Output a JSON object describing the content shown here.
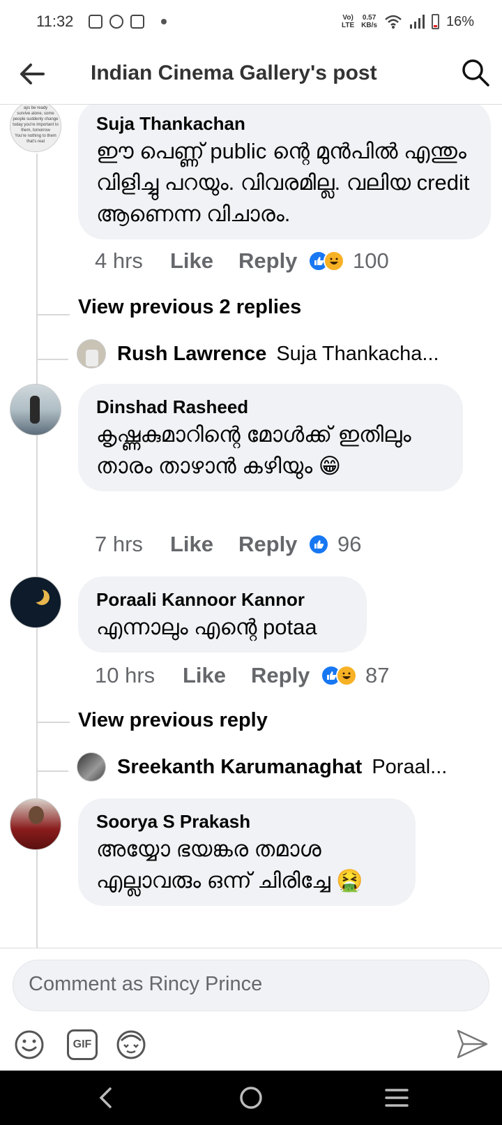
{
  "status": {
    "time": "11:32",
    "lte": "LTE",
    "speed_value": "0.57",
    "speed_unit": "KB/s",
    "battery": "16%",
    "volte": "Vo)"
  },
  "header": {
    "title": "Indian Cinema Gallery's post"
  },
  "comments": [
    {
      "author": "Suja Thankachan",
      "text": "ഈ പെണ്ണ് public ന്റെ മുൻപിൽ എന്തും വിളിച്ചു പറയും. വിവരമില്ല. വലിയ credit ആണെന്ന വിചാരം.",
      "time": "4 hrs",
      "like": "Like",
      "reply": "Reply",
      "reaction_count": "100",
      "view_previous": "View previous 2 replies",
      "latest_reply_name": "Rush Lawrence",
      "latest_reply_preview": "Suja Thankacha..."
    },
    {
      "author": "Dinshad Rasheed",
      "text": "കൃഷ്ണകുമാറിന്റെ മോൾക്ക് ഇതിലും താരം താഴാൻ കഴിയും 😁",
      "time": "7 hrs",
      "like": "Like",
      "reply": "Reply",
      "reaction_count": "96"
    },
    {
      "author": "Poraali Kannoor Kannor",
      "text": "എന്നാലും എന്റെ potaa",
      "time": "10 hrs",
      "like": "Like",
      "reply": "Reply",
      "reaction_count": "87",
      "view_previous": "View previous reply",
      "latest_reply_name": "Sreekanth Karumanaghat",
      "latest_reply_preview": "Poraal..."
    },
    {
      "author": "Soorya S Prakash",
      "text": "അയ്യോ ഭയങ്കര തമാശ എല്ലാവരും ഒന്ന് ചിരിച്ചേ 🤮"
    }
  ],
  "avatar_text": [
    "ays be ready",
    "survive alone, some",
    "people suddenly change",
    "today you're important to",
    "them, tomorrow",
    "You're nothing to them",
    "that's real"
  ],
  "composer": {
    "placeholder": "Comment as Rincy Prince",
    "gif": "GIF"
  },
  "colors": {
    "bubble": "#f0f2f5",
    "like_blue": "#1877f2",
    "haha_yellow": "#f7b125",
    "meta_gray": "#65676b"
  }
}
